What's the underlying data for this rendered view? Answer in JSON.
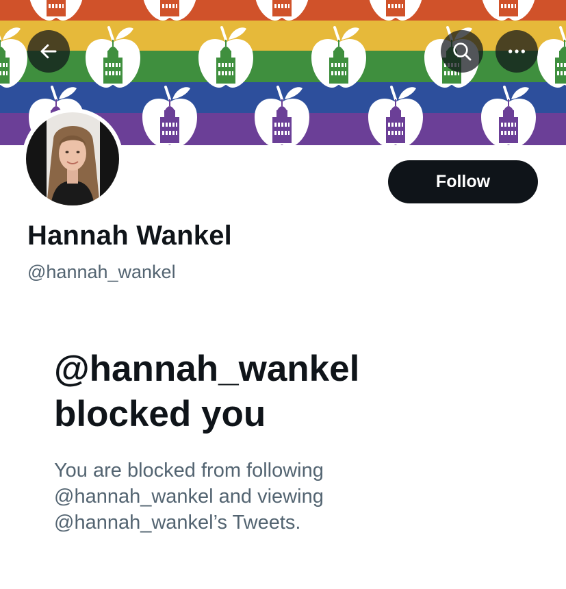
{
  "header": {
    "back_icon": "arrow-left-icon",
    "search_icon": "search-icon",
    "more_icon": "more-horizontal-icon"
  },
  "banner": {
    "stripe_colors": [
      "#d0522a",
      "#e6b93a",
      "#3f8f3e",
      "#2d4f9c",
      "#6b3f97"
    ],
    "motif": "apple-with-capitol-building"
  },
  "profile": {
    "display_name": "Hannah Wankel",
    "handle": "@hannah_wankel",
    "follow_label": "Follow"
  },
  "blocked": {
    "title_line1": "@hannah_wankel",
    "title_line2": "blocked you",
    "desc_line1": "You are blocked from following",
    "desc_line2": "@hannah_wankel and viewing",
    "desc_line3": "@hannah_wankel’s Tweets."
  },
  "colors": {
    "text_primary": "#0f1419",
    "text_secondary": "#536471",
    "button_bg": "#0f1419",
    "button_text": "#ffffff"
  }
}
